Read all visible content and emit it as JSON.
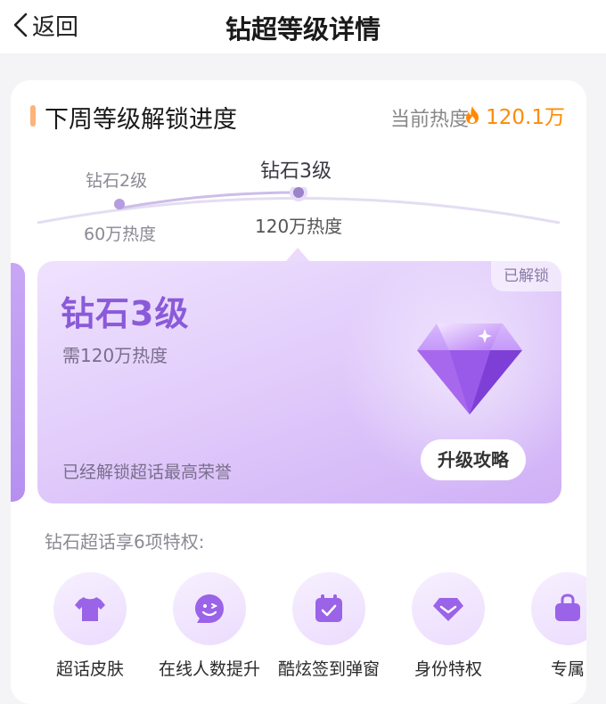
{
  "nav": {
    "back_label": "返回",
    "title": "钻超等级详情"
  },
  "section": {
    "title": "下周等级解锁进度",
    "heat_label": "当前热度",
    "heat_value": "120.1万"
  },
  "progress": {
    "prev_level": "钻石2级",
    "prev_heat": "60万热度",
    "current_level": "钻石3级",
    "current_heat": "120万热度"
  },
  "hero": {
    "badge": "已解锁",
    "title": "钻石3级",
    "requirement": "需120万热度",
    "note": "已经解锁超话最高荣誉",
    "button": "升级攻略"
  },
  "privileges": {
    "title": "钻石超话享6项特权:",
    "items": [
      {
        "label": "超话皮肤",
        "icon": "tshirt-icon"
      },
      {
        "label": "在线人数提升",
        "icon": "smile-icon"
      },
      {
        "label": "酷炫签到弹窗",
        "icon": "calendar-check-icon"
      },
      {
        "label": "身份特权",
        "icon": "diamond-icon"
      },
      {
        "label": "专属",
        "icon": "bag-icon"
      }
    ]
  },
  "colors": {
    "accent": "#ff8a00",
    "primary": "#8a5ad9",
    "hero_bg": "#e2cdfb"
  }
}
